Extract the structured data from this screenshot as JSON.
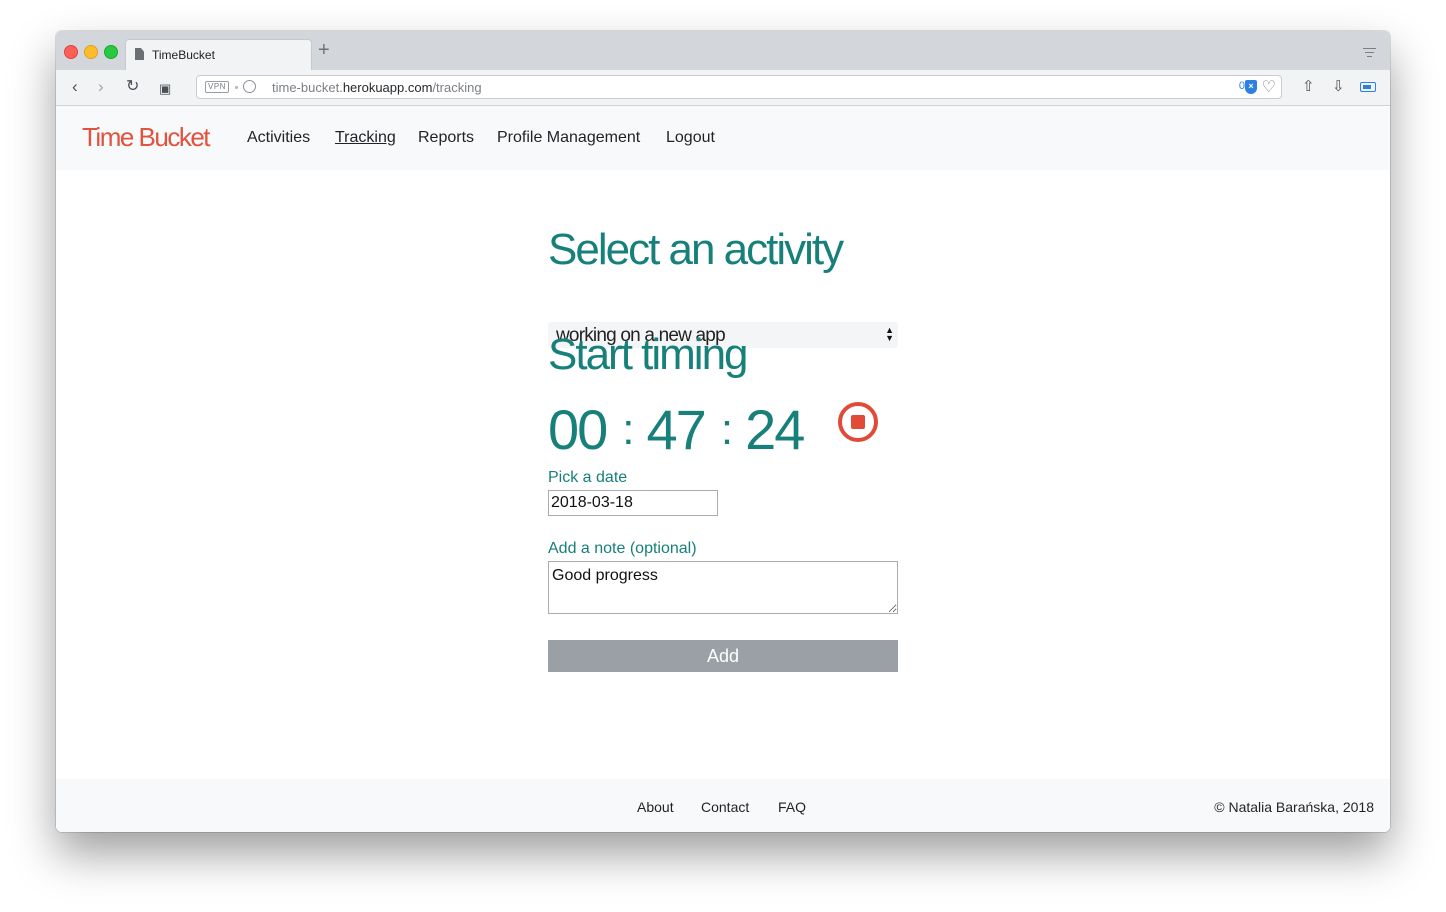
{
  "browser": {
    "tab_title": "TimeBucket",
    "new_tab_label": "+",
    "vpn_label": "VPN",
    "url_prefix": "time-bucket.",
    "url_domain": "herokuapp.com",
    "url_path": "/tracking",
    "ad_block_count": "0",
    "shield_label": "×"
  },
  "nav": {
    "brand": "Time Bucket",
    "items": [
      {
        "label": "Activities",
        "active": false
      },
      {
        "label": "Tracking",
        "active": true
      },
      {
        "label": "Reports",
        "active": false
      },
      {
        "label": "Profile Management",
        "active": false
      },
      {
        "label": "Logout",
        "active": false
      }
    ]
  },
  "tracking": {
    "select_heading": "Select an activity",
    "selected_activity": "working on a new app",
    "timing_heading": "Start timing",
    "timer": {
      "hours": "00",
      "minutes": "47",
      "seconds": "24",
      "separator": ":"
    },
    "date_label": "Pick a date",
    "date_value": "2018-03-18",
    "note_label": "Add a note (optional)",
    "note_value": "Good progress",
    "add_button": "Add"
  },
  "footer": {
    "links": [
      "About",
      "Contact",
      "FAQ"
    ],
    "copyright": "© Natalia Barańska, 2018"
  },
  "colors": {
    "brand": "#e0533f",
    "teal": "#17807a",
    "stop": "#e04a36",
    "button": "#9aa0a6"
  }
}
